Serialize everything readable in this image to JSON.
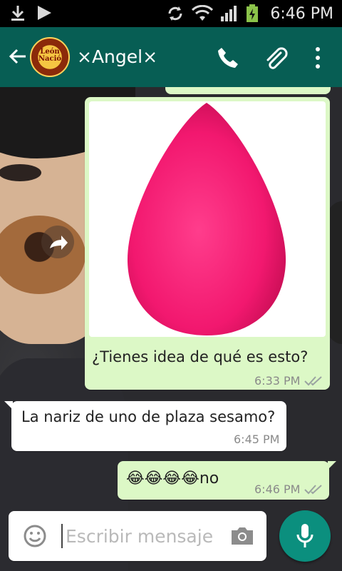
{
  "status_bar": {
    "time": "6:46 PM",
    "icons": [
      "download-icon",
      "play-store-icon",
      "sync-icon",
      "wifi-icon",
      "signal-icon",
      "battery-charging-icon"
    ]
  },
  "header": {
    "contact_name": "×Angel×",
    "avatar_text": "León Nació",
    "icons": [
      "back-arrow-icon",
      "phone-icon",
      "paperclip-icon",
      "more-vert-icon"
    ]
  },
  "messages": [
    {
      "direction": "outgoing",
      "type": "image",
      "image_content": "pink-sponge",
      "text": "¿Tienes idea de qué es esto?",
      "time": "6:33 PM",
      "status": "read"
    },
    {
      "direction": "incoming",
      "type": "text",
      "text": "La nariz de uno de plaza sesamo?",
      "time": "6:45 PM"
    },
    {
      "direction": "outgoing",
      "type": "text",
      "text": "😂😂😂😂no",
      "time": "6:46 PM",
      "status": "read"
    }
  ],
  "composer": {
    "placeholder": "Escribir mensaje",
    "value": ""
  },
  "colors": {
    "header": "#075e54",
    "outgoing_bubble": "#dcf8c6",
    "incoming_bubble": "#ffffff",
    "mic_button": "#0b8f7e",
    "sponge": "#f2186f"
  }
}
